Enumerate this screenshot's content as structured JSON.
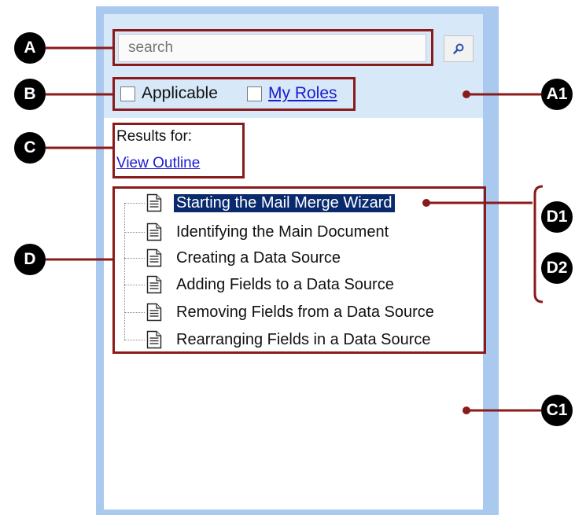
{
  "search": {
    "placeholder": "search"
  },
  "filters": {
    "applicable_label": "Applicable",
    "my_roles_label": "My Roles"
  },
  "results": {
    "results_for_label": "Results for:",
    "view_outline_link": "View Outline"
  },
  "tree": {
    "items": [
      {
        "label": "Starting the Mail Merge Wizard",
        "selected": true
      },
      {
        "label": "Identifying the Main Document",
        "selected": false
      },
      {
        "label": "Creating a Data Source",
        "selected": false
      },
      {
        "label": "Adding Fields to a Data Source",
        "selected": false
      },
      {
        "label": "Removing Fields from a Data Source",
        "selected": false
      },
      {
        "label": "Rearranging Fields in a Data Source",
        "selected": false
      }
    ]
  },
  "annotations": {
    "a": "A",
    "a1": "A1",
    "b": "B",
    "c": "C",
    "c1": "C1",
    "d": "D",
    "d1": "D1",
    "d2": "D2"
  },
  "colors": {
    "panel_border": "#a9c9ee",
    "header_bg": "#d7e8f9",
    "annotation": "#8b1a1a",
    "selection": "#0a2a6e",
    "link": "#1a1ad0"
  },
  "icons": {
    "search_button": "magnifier-icon",
    "tree_item": "document-icon"
  }
}
